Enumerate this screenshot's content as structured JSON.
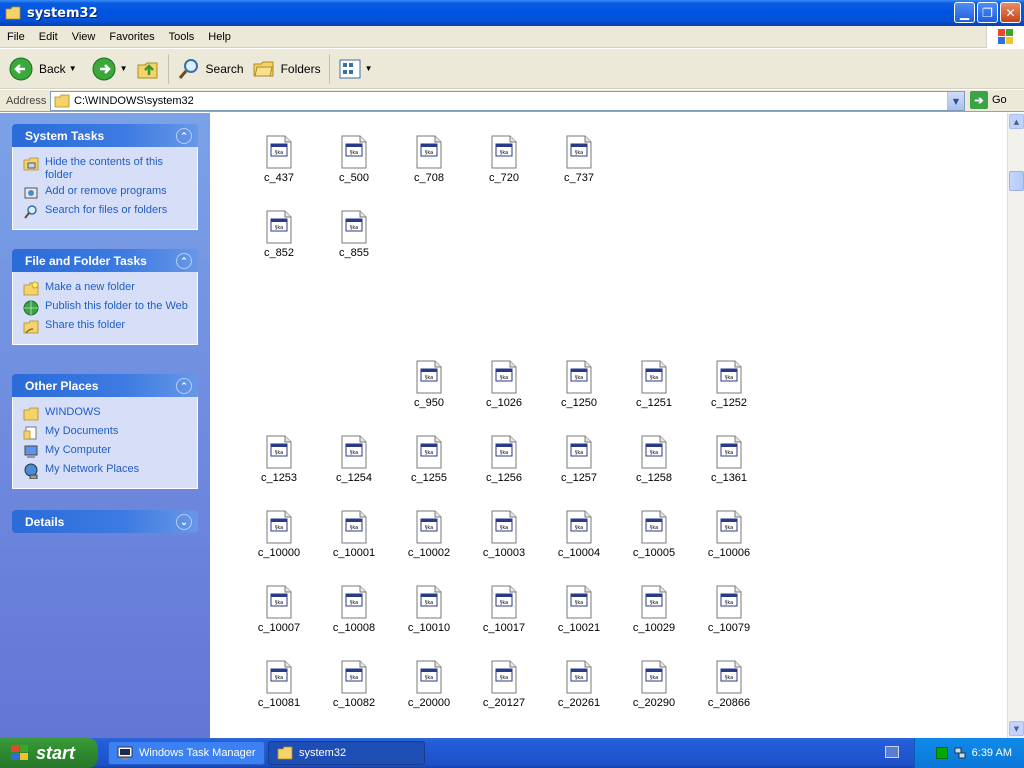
{
  "window": {
    "title": "system32"
  },
  "menu": [
    "File",
    "Edit",
    "View",
    "Favorites",
    "Tools",
    "Help"
  ],
  "toolbar": {
    "back_label": "Back",
    "search_label": "Search",
    "folders_label": "Folders"
  },
  "address": {
    "label": "Address",
    "value": "C:\\WINDOWS\\system32",
    "go_label": "Go"
  },
  "panels": {
    "system_tasks": {
      "title": "System Tasks",
      "items": [
        "Hide the contents of this folder",
        "Add or remove programs",
        "Search for files or folders"
      ]
    },
    "file_folder_tasks": {
      "title": "File and Folder Tasks",
      "items": [
        "Make a new folder",
        "Publish this folder to the Web",
        "Share this folder"
      ]
    },
    "other_places": {
      "title": "Other Places",
      "items": [
        "WINDOWS",
        "My Documents",
        "My Computer",
        "My Network Places"
      ]
    },
    "details": {
      "title": "Details"
    }
  },
  "files": [
    "c_437",
    "c_500",
    "c_708",
    "c_720",
    "c_737",
    "c_852",
    "c_855",
    "c_950",
    "c_1026",
    "c_1250",
    "c_1251",
    "c_1252",
    "c_1253",
    "c_1254",
    "c_1255",
    "c_1256",
    "c_1257",
    "c_1258",
    "c_1361",
    "c_10000",
    "c_10001",
    "c_10002",
    "c_10003",
    "c_10004",
    "c_10005",
    "c_10006",
    "c_10007",
    "c_10008",
    "c_10010",
    "c_10017",
    "c_10021",
    "c_10029",
    "c_10079",
    "c_10081",
    "c_10082",
    "c_20000",
    "c_20127",
    "c_20261",
    "c_20290",
    "c_20866"
  ],
  "taskbar": {
    "start_label": "start",
    "items": [
      "Windows Task Manager",
      "system32"
    ],
    "clock": "6:39 AM"
  },
  "colors": {
    "title_blue": "#0054e3",
    "panel_link": "#215dc6",
    "start_green": "#2f8c2f"
  }
}
